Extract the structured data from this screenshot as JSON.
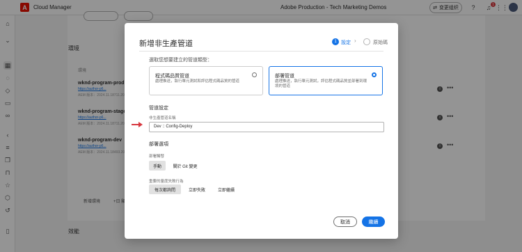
{
  "app": {
    "logo_letter": "A",
    "name": "Cloud Manager"
  },
  "header": {
    "org": "Adobe Production - Tech Marketing Demos",
    "switch_label": "变更组织",
    "notification_count": "1"
  },
  "background": {
    "section_title": "環境",
    "column_head": "環境",
    "rows": [
      {
        "name": "wknd-program-prod",
        "link": "https://author-p6...",
        "meta": "AEM 版本：2024.11.18711.20241..."
      },
      {
        "name": "wknd-program-stage",
        "link": "https://author-p6...",
        "meta": "AEM 版本：2024.11.18711.20241..."
      },
      {
        "name": "wknd-program-dev",
        "link": "https://author-p6...",
        "meta": "AEM 版本：2024.11.18493.20241..."
      }
    ],
    "bottom_left": "新增環境",
    "bottom_mid": "+日 顯示全部",
    "effect_title": "效能"
  },
  "modal": {
    "title": "新增非生產管道",
    "step1_num": "1",
    "step1_label": "設定",
    "step2_label": "原始碼",
    "prompt": "選取您想要建立的管道類型：",
    "options": [
      {
        "title": "程式碼品質管道",
        "desc": "處理推送，執行單元測試和評估程式碼品質的管道",
        "selected": false
      },
      {
        "title": "部署管道",
        "desc": "處理推送，執行單元測試，評估程式碼品質並部署到環境的管道",
        "selected": true
      }
    ],
    "pipeline_settings": "管道設定",
    "name_label": "非生產管道名稱",
    "name_value": "Dev :: Config-Deploy",
    "deploy_options": "部署選項",
    "deploy_trigger_label": "部署觸發",
    "trigger_options": [
      "手動",
      "關於 Git 變更"
    ],
    "important_label": "重要的量度失敗行為",
    "behavior_options": [
      "每次都詢問",
      "立即失敗",
      "立即繼續"
    ],
    "cancel": "取消",
    "continue": "繼續"
  }
}
